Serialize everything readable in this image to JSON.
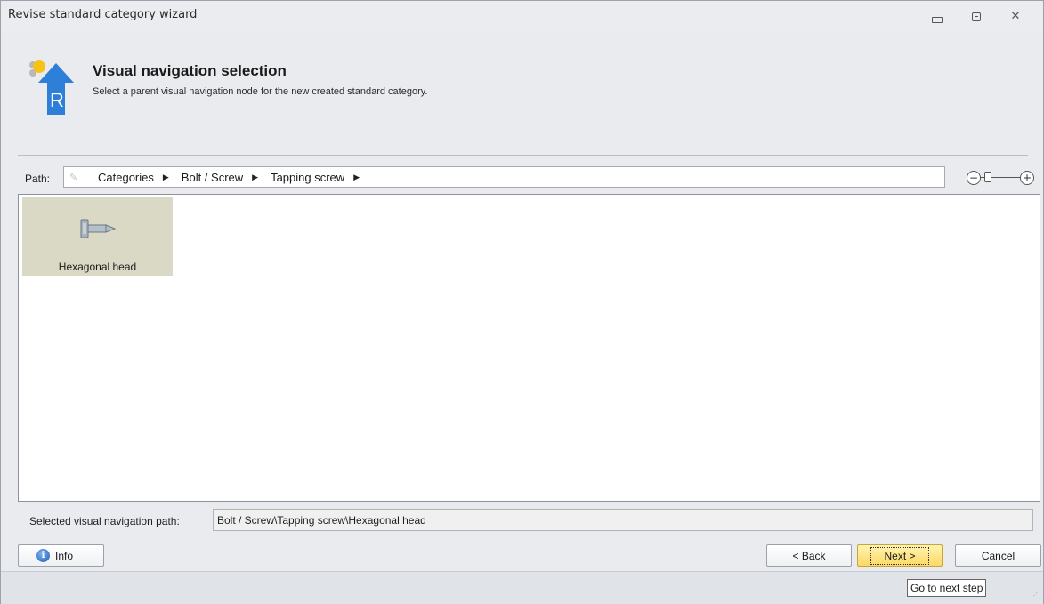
{
  "window": {
    "title": "Revise standard category wizard",
    "minimize_icon": "minimize-icon",
    "maximize_icon": "maximize-icon",
    "close_icon": "close-icon",
    "close_glyph": "✕"
  },
  "header": {
    "title": "Visual navigation selection",
    "subtitle": "Select a parent visual navigation node for the new created standard category.",
    "logo_icon": "revise-wizard-logo-icon",
    "logo_letter": "R"
  },
  "path_bar": {
    "label": "Path:",
    "edit_icon": "pencil-icon",
    "crumbs": [
      "Categories",
      "Bolt / Screw",
      "Tapping screw"
    ],
    "crumb_arrow": "▶",
    "zoom_minus": "−",
    "zoom_plus": "+"
  },
  "pane": {
    "items": [
      {
        "label": "Hexagonal head",
        "icon": "hex-head-screw-icon",
        "selected": true
      }
    ]
  },
  "selection": {
    "label": "Selected visual navigation path:",
    "value": "Bolt / Screw\\Tapping screw\\Hexagonal head"
  },
  "buttons": {
    "info": "Info",
    "info_glyph": "i",
    "back": "< Back",
    "next": "Next >",
    "cancel": "Cancel"
  },
  "status": {
    "tooltip": "Go to next step"
  },
  "colors": {
    "accent_blue": "#2d7fd8",
    "tile_selected": "#d9d9c6",
    "next_button": "#fcd964"
  }
}
